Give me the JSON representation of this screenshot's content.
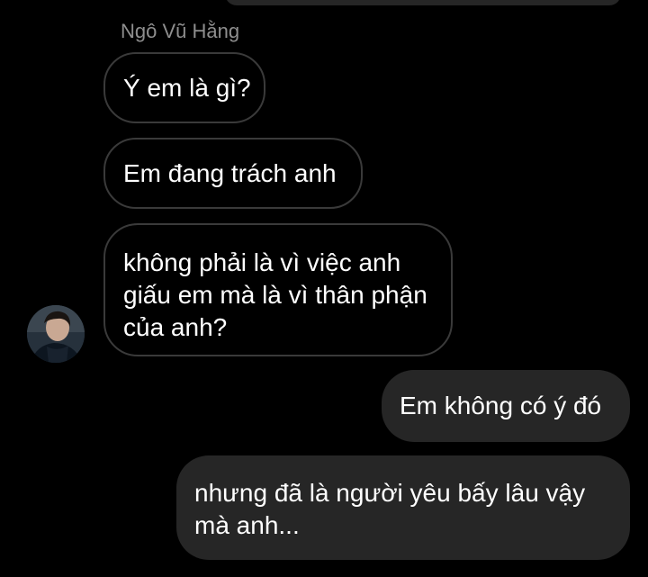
{
  "chat": {
    "sender_name": "Ngô Vũ Hằng",
    "incoming": [
      "Ý em là gì?",
      "Em đang trách anh",
      "không phải là vì việc anh giấu em mà là vì thân phận của anh?"
    ],
    "outgoing": [
      "Em không có ý đó",
      "nhưng đã là người yêu bấy lâu vậy mà anh..."
    ]
  },
  "colors": {
    "background": "#000000",
    "incoming_border": "#3a3a3a",
    "outgoing_fill": "#262626",
    "sender_name": "#8e8e8e"
  }
}
